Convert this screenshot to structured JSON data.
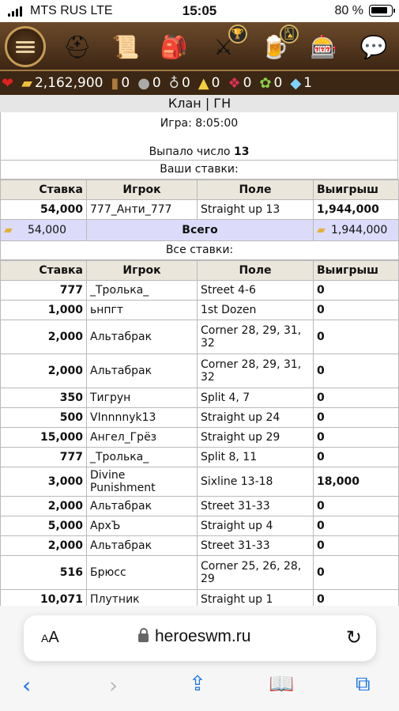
{
  "status_bar": {
    "carrier": "MTS RUS  LTE",
    "time": "15:05",
    "battery": "80 %"
  },
  "top_icons": [
    "menu-icon",
    "knight-helmet-icon",
    "scroll-map-icon",
    "backpack-icon",
    "swords-trophy-icon",
    "castle-mug-icon",
    "roulette-coins-icon",
    "chat-icon"
  ],
  "resources": [
    {
      "icon": "heart-icon",
      "value": ""
    },
    {
      "icon": "gold-icon",
      "value": "2,162,900"
    },
    {
      "icon": "wood-icon",
      "value": "0"
    },
    {
      "icon": "ore-icon",
      "value": "0"
    },
    {
      "icon": "mercury-icon",
      "value": "0"
    },
    {
      "icon": "sulfur-icon",
      "value": "0"
    },
    {
      "icon": "crystal-icon",
      "value": "0"
    },
    {
      "icon": "gems-icon",
      "value": "0"
    },
    {
      "icon": "diamond-icon",
      "value": "1"
    }
  ],
  "page_title": "Клан | ГН",
  "game": {
    "label": "Игра: 8:05:00",
    "result_prefix": "Выпало число",
    "result_number": "13"
  },
  "your_bets": {
    "title": "Ваши ставки:",
    "headers": {
      "stake": "Ставка",
      "player": "Игрок",
      "field": "Поле",
      "win": "Выигрыш"
    },
    "rows": [
      {
        "stake": "54,000",
        "player": "777_Анти_777",
        "field": "Straight up 13",
        "win": "1,944,000"
      }
    ],
    "total": {
      "stake": "54,000",
      "label": "Всего",
      "win": "1,944,000"
    }
  },
  "all_bets": {
    "title": "Все ставки:",
    "headers": {
      "stake": "Ставка",
      "player": "Игрок",
      "field": "Поле",
      "win": "Выигрыш"
    },
    "rows": [
      {
        "stake": "777",
        "player": "_Тролька_",
        "field": "Street 4-6",
        "win": "0"
      },
      {
        "stake": "1,000",
        "player": "ьнпгт",
        "field": "1st Dozen",
        "win": "0"
      },
      {
        "stake": "2,000",
        "player": "Альтабрак",
        "field": "Corner 28, 29, 31, 32",
        "win": "0"
      },
      {
        "stake": "2,000",
        "player": "Альтабрак",
        "field": "Corner 28, 29, 31, 32",
        "win": "0"
      },
      {
        "stake": "350",
        "player": "Тигрун",
        "field": "Split 4, 7",
        "win": "0"
      },
      {
        "stake": "500",
        "player": "VInnnnyk13",
        "field": "Straight up 24",
        "win": "0"
      },
      {
        "stake": "15,000",
        "player": "Ангел_Грёз",
        "field": "Straight up 29",
        "win": "0"
      },
      {
        "stake": "777",
        "player": "_Тролька_",
        "field": "Split 8, 11",
        "win": "0"
      },
      {
        "stake": "3,000",
        "player": "Divine Punishment",
        "field": "Sixline 13-18",
        "win": "18,000"
      },
      {
        "stake": "2,000",
        "player": "Альтабрак",
        "field": "Street 31-33",
        "win": "0"
      },
      {
        "stake": "5,000",
        "player": "АрхЪ",
        "field": "Straight up 4",
        "win": "0"
      },
      {
        "stake": "2,000",
        "player": "Альтабрак",
        "field": "Street 31-33",
        "win": "0"
      },
      {
        "stake": "516",
        "player": "Брюсс",
        "field": "Corner 25, 26, 28, 29",
        "win": "0"
      },
      {
        "stake": "10,071",
        "player": "Плутник",
        "field": "Straight up 1",
        "win": "0"
      }
    ]
  },
  "browser": {
    "aa_label": "AA",
    "url": "heroeswm.ru"
  }
}
